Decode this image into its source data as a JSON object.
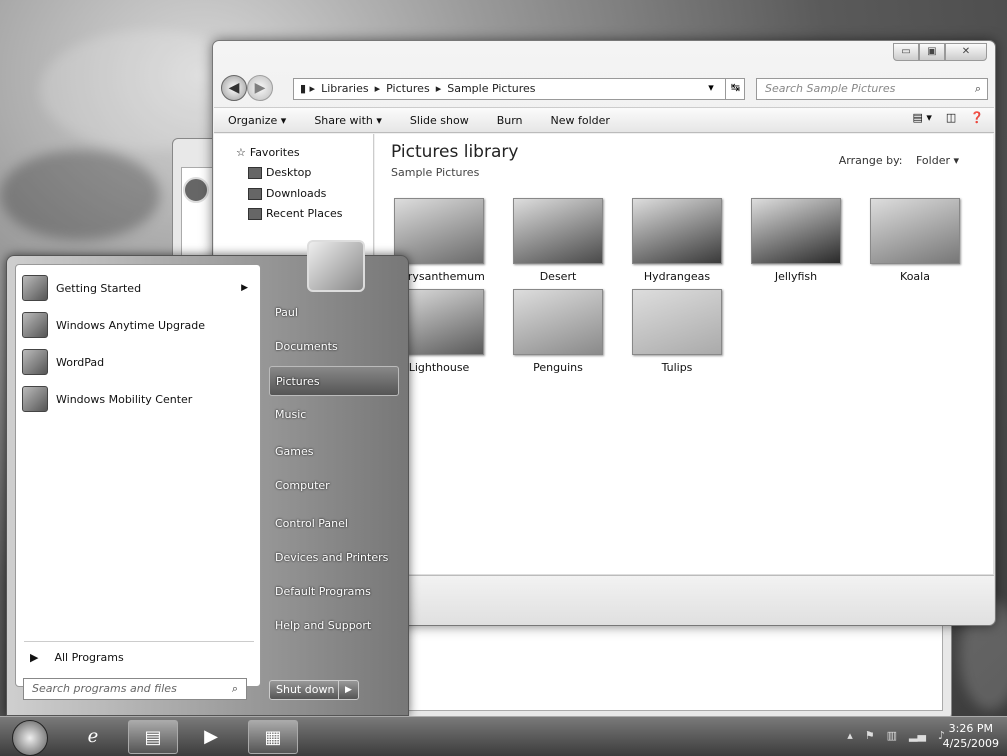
{
  "explorer": {
    "window_buttons": [
      "▭",
      "▣",
      "✕"
    ],
    "breadcrumbs": [
      "Libraries",
      "Pictures",
      "Sample Pictures"
    ],
    "search_placeholder": "Search Sample Pictures",
    "toolbar": {
      "organize": "Organize ▾",
      "share": "Share with ▾",
      "slideshow": "Slide show",
      "burn": "Burn",
      "new_folder": "New folder"
    },
    "nav_pane": {
      "favorites": "Favorites",
      "desktop": "Desktop",
      "downloads": "Downloads",
      "recent": "Recent Places"
    },
    "library_title": "Pictures library",
    "library_subtitle": "Sample Pictures",
    "arrange_label": "Arrange by:",
    "arrange_value": "Folder ▾",
    "thumbnails": [
      {
        "label": "Chrysanthemum",
        "color": "#6a6a6a"
      },
      {
        "label": "Desert",
        "color": "#4a4a4a"
      },
      {
        "label": "Hydrangeas",
        "color": "#3a3a3a"
      },
      {
        "label": "Jellyfish",
        "color": "#2a2a2a"
      },
      {
        "label": "Koala",
        "color": "#777777"
      },
      {
        "label": "Lighthouse",
        "color": "#5a5a5a"
      },
      {
        "label": "Penguins",
        "color": "#8a8a8a"
      },
      {
        "label": "Tulips",
        "color": "#aaaaaa"
      }
    ]
  },
  "start_menu": {
    "programs": [
      {
        "label": "Getting Started",
        "arrow": "▶"
      },
      {
        "label": "Windows Anytime Upgrade"
      },
      {
        "label": "WordPad"
      },
      {
        "label": "Windows Mobility Center"
      }
    ],
    "all_programs": "All Programs",
    "search_placeholder": "Search programs and files",
    "right_links": [
      "Paul",
      "Documents",
      "Pictures",
      "Music",
      "Games",
      "Computer",
      "Control Panel",
      "Devices and Printers",
      "Default Programs",
      "Help and Support"
    ],
    "selected": "Pictures",
    "shutdown": "Shut down"
  },
  "taskbar": {
    "time": "3:26 PM",
    "date": "4/25/2009"
  }
}
